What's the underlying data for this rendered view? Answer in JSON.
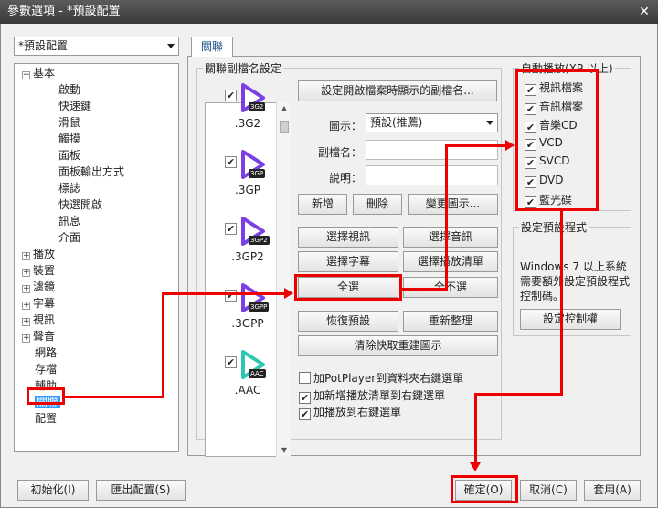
{
  "window": {
    "title": "參數選項 - *預設配置",
    "close": "✕"
  },
  "profile_combo": "*預設配置",
  "tree": [
    {
      "label": "基本",
      "toggle": "−"
    },
    {
      "label": "啟動"
    },
    {
      "label": "快速鍵"
    },
    {
      "label": "滑鼠"
    },
    {
      "label": "觸摸"
    },
    {
      "label": "面板"
    },
    {
      "label": "面板輸出方式"
    },
    {
      "label": "標誌"
    },
    {
      "label": "快選開啟"
    },
    {
      "label": "訊息"
    },
    {
      "label": "介面"
    },
    {
      "label": "播放",
      "toggle": "+"
    },
    {
      "label": "裝置",
      "toggle": "+"
    },
    {
      "label": "濾鏡",
      "toggle": "+"
    },
    {
      "label": "字幕",
      "toggle": "+"
    },
    {
      "label": "視訊",
      "toggle": "+"
    },
    {
      "label": "聲音",
      "toggle": "+"
    },
    {
      "label": "網路"
    },
    {
      "label": "存檔"
    },
    {
      "label": "輔助"
    },
    {
      "label": "關聯",
      "selected": true
    },
    {
      "label": "配置"
    }
  ],
  "tab": "關聯",
  "assoc": {
    "legend": "關聯副檔名設定",
    "formats": [
      {
        "name": ".3G2",
        "tag": "3G2",
        "color": "#7b3fe4",
        "checked": "✔"
      },
      {
        "name": ".3GP",
        "tag": "3GP",
        "color": "#7b3fe4",
        "checked": "✔"
      },
      {
        "name": ".3GP2",
        "tag": "3GP2",
        "color": "#7b3fe4",
        "checked": "✔"
      },
      {
        "name": ".3GPP",
        "tag": "3GPP",
        "color": "#7b3fe4",
        "checked": "✔"
      },
      {
        "name": ".AAC",
        "tag": "AAC",
        "color": "#2bc7b4",
        "checked": "✔"
      }
    ],
    "set_ext_btn": "設定開啟檔案時顯示的副檔名...",
    "icon_label": "圖示：",
    "icon_value": "預設(推薦)",
    "ext_label": "副檔名：",
    "desc_label": "說明：",
    "add_btn": "新增",
    "del_btn": "刪除",
    "change_icon_btn": "變更圖示...",
    "sel_video_btn": "選擇視訊",
    "sel_audio_btn": "選擇音訊",
    "sel_sub_btn": "選擇字幕",
    "sel_playlist_btn": "選擇播放清單",
    "select_all_btn": "全選",
    "select_none_btn": "全不選",
    "restore_btn": "恢復預設",
    "reorg_btn": "重新整理",
    "clear_cache_btn": "清除快取重建圖示",
    "ctx_folder": "加PotPlayer到資料夾右鍵選單",
    "ctx_add": "加新增播放清單到右鍵選單",
    "ctx_play": "加播放到右鍵選單"
  },
  "autoplay": {
    "legend": "自動播放(XP 以上)",
    "items": [
      "視訊檔案",
      "音訊檔案",
      "音樂CD",
      "VCD",
      "SVCD",
      "DVD",
      "藍光碟"
    ]
  },
  "default_prog": {
    "legend": "設定預設程式",
    "text": "Windows 7 以上系統需要額外設定預設程式控制碼。",
    "btn": "設定控制權"
  },
  "footer": {
    "init_btn": "初始化(I)",
    "export_btn": "匯出配置(S)",
    "ok_btn": "確定(O)",
    "cancel_btn": "取消(C)",
    "apply_btn": "套用(A)"
  },
  "colors": {
    "annotation": "#e00000",
    "selection": "#3399ff"
  }
}
